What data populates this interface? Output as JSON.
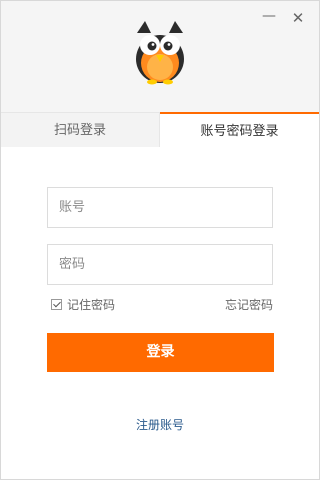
{
  "window": {
    "minimize_icon": "minimize-icon",
    "close_icon": "close-icon",
    "logo": "owl-logo"
  },
  "tabs": [
    {
      "label": "扫码登录",
      "active": false
    },
    {
      "label": "账号密码登录",
      "active": true
    }
  ],
  "form": {
    "account_placeholder": "账号",
    "account_value": "",
    "password_placeholder": "密码",
    "password_value": "",
    "remember_label": "记住密码",
    "remember_checked": true,
    "forgot_label": "忘记密码",
    "login_label": "登录",
    "register_label": "注册账号"
  },
  "colors": {
    "accent": "#ff6a00",
    "link": "#2a5a8c"
  }
}
